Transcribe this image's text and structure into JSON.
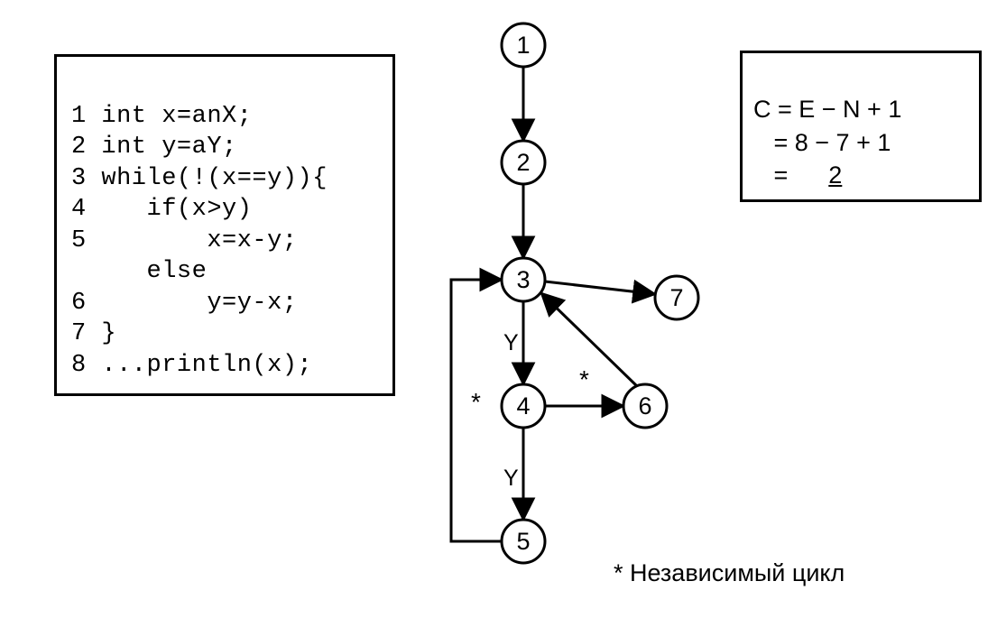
{
  "code": {
    "l1": "1 int x=anX;",
    "l2": "2 int y=aY;",
    "l3": "3 while(!(x==y)){",
    "l4": "4    if(x>y)",
    "l5": "5        x=x-y;",
    "l6": "     else",
    "l7": "6        y=y-x;",
    "l8": "7 }",
    "l9": "8 ...println(x);"
  },
  "formula": {
    "line1": "C = E − N + 1",
    "line2": "   = 8 − 7 + 1",
    "line3_prefix": "   =      ",
    "result": "2"
  },
  "graph": {
    "nodes": {
      "n1": "1",
      "n2": "2",
      "n3": "3",
      "n4": "4",
      "n5": "5",
      "n6": "6",
      "n7": "7"
    },
    "labels": {
      "y": "Y",
      "star": "*"
    }
  },
  "footnote": "* Независимый цикл"
}
